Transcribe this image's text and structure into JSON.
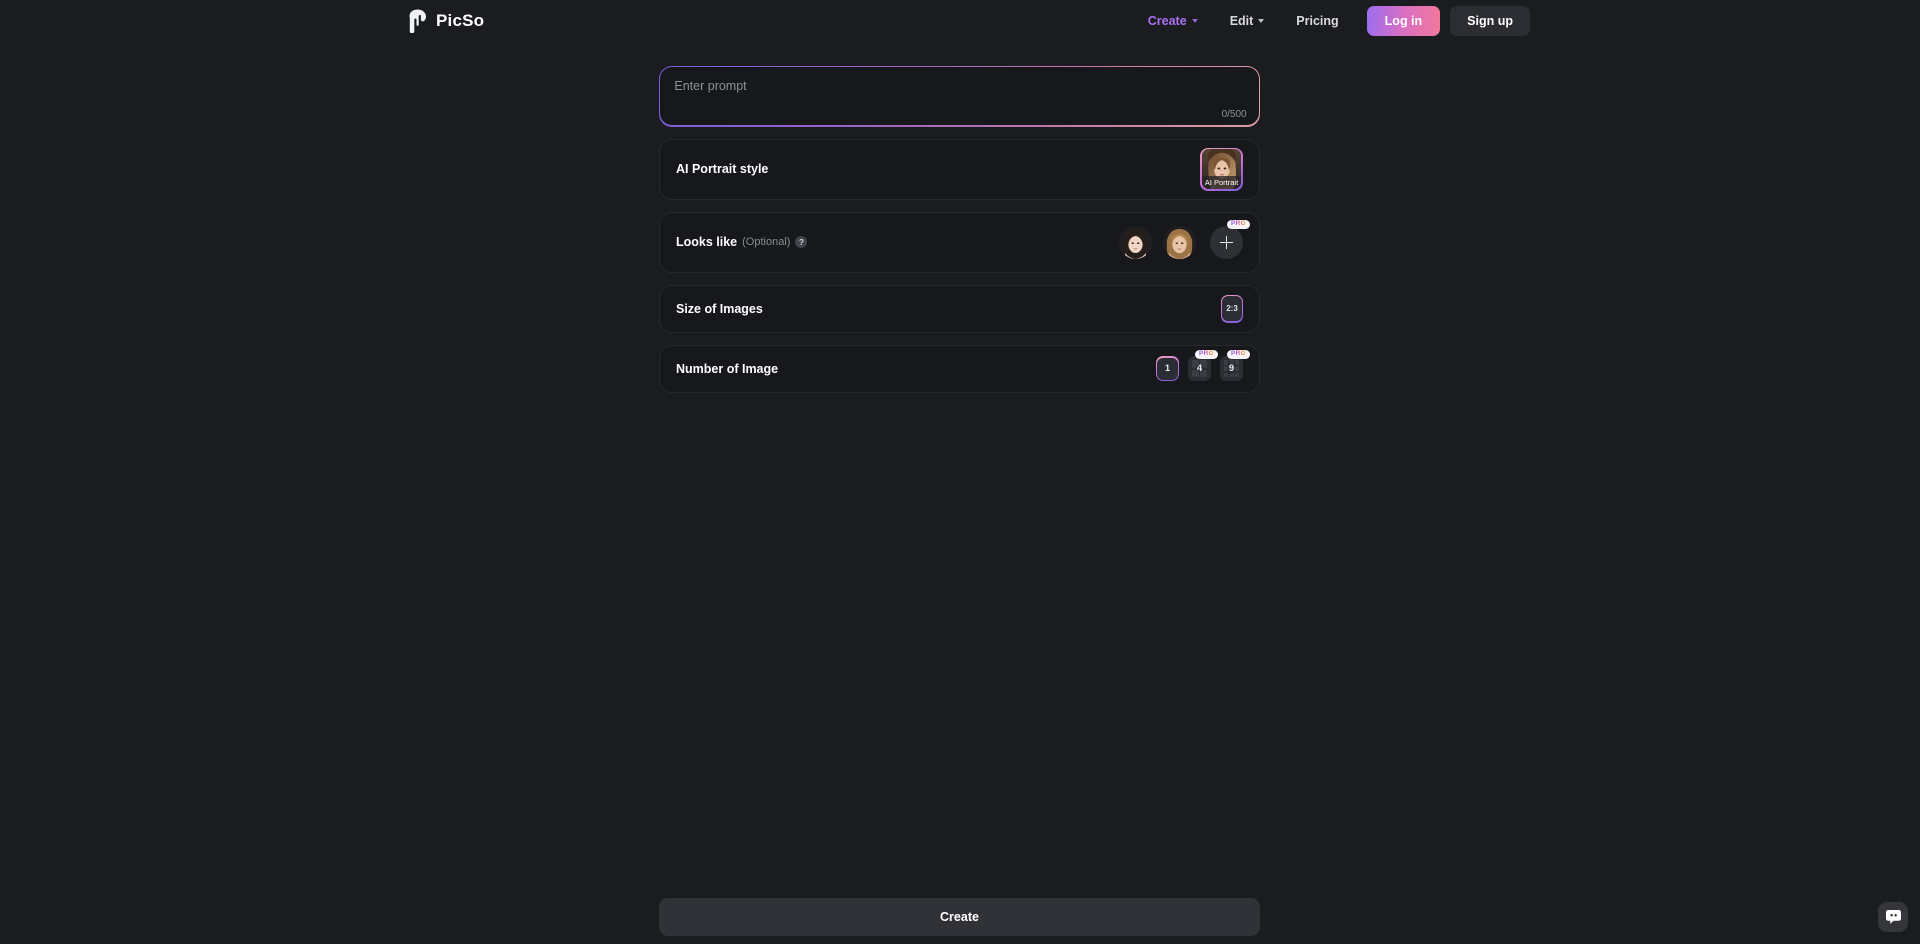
{
  "header": {
    "logo_name": "picso-logo-icon",
    "brand": "PicSo",
    "nav": [
      {
        "label": "Create",
        "has_caret": true,
        "active": true
      },
      {
        "label": "Edit",
        "has_caret": true,
        "active": false
      },
      {
        "label": "Pricing",
        "has_caret": false,
        "active": false
      }
    ],
    "login_label": "Log in",
    "signup_label": "Sign up"
  },
  "prompt": {
    "placeholder": "Enter prompt",
    "value": "",
    "counter": "0/500"
  },
  "style_section": {
    "label": "AI Portrait style",
    "selected_style": "AI Portrait"
  },
  "looks_like": {
    "label": "Looks like",
    "optional_text": "(Optional)",
    "help_icon": "?",
    "faces": [
      {
        "name": "face-option-1"
      },
      {
        "name": "face-option-2"
      }
    ],
    "add_label": "+",
    "add_badge": "PRO"
  },
  "size_section": {
    "label": "Size of Images",
    "selected_ratio": "2:3"
  },
  "number_section": {
    "label": "Number of Image",
    "options": [
      {
        "value": "1",
        "selected": true,
        "pro": false,
        "grid": 1
      },
      {
        "value": "4",
        "selected": false,
        "pro": true,
        "grid": 2
      },
      {
        "value": "9",
        "selected": false,
        "pro": true,
        "grid": 3
      }
    ],
    "pro_badge": "PRO"
  },
  "footer": {
    "create_label": "Create"
  },
  "chat": {
    "icon": "chat-bubble-icon"
  },
  "colors": {
    "page_bg": "#1a1c20",
    "card_bg": "#16181c",
    "accent_purple": "#a970f0",
    "accent_pink": "#f2789a",
    "text_primary": "#ffffff",
    "text_muted": "#8d9096"
  }
}
